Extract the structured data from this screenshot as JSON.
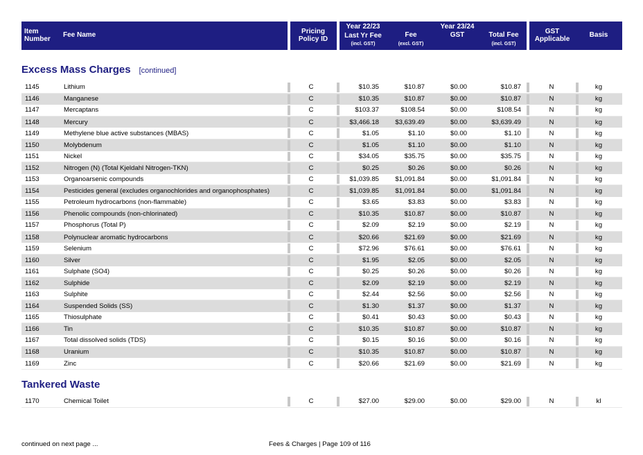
{
  "header": {
    "item_number": "Item Number",
    "fee_name": "Fee Name",
    "pricing_policy": "Pricing Policy ID",
    "year_prev": "Year 22/23",
    "year_prev_sub": "Last Yr Fee",
    "year_prev_note": "(incl. GST)",
    "year_curr": "Year 23/24",
    "fee": "Fee",
    "fee_note": "(excl. GST)",
    "gst": "GST",
    "total_fee": "Total Fee",
    "total_note": "(incl. GST)",
    "gst_applicable": "GST Applicable",
    "basis": "Basis"
  },
  "sections": [
    {
      "title": "Excess Mass Charges",
      "subtitle": "[continued]",
      "rows": [
        {
          "num": "1145",
          "name": "Lithium",
          "policy": "C",
          "prev": "$10.35",
          "fee": "$10.87",
          "gst": "$0.00",
          "total": "$10.87",
          "applicable": "N",
          "basis": "kg"
        },
        {
          "num": "1146",
          "name": "Manganese",
          "policy": "C",
          "prev": "$10.35",
          "fee": "$10.87",
          "gst": "$0.00",
          "total": "$10.87",
          "applicable": "N",
          "basis": "kg"
        },
        {
          "num": "1147",
          "name": "Mercaptans",
          "policy": "C",
          "prev": "$103.37",
          "fee": "$108.54",
          "gst": "$0.00",
          "total": "$108.54",
          "applicable": "N",
          "basis": "kg"
        },
        {
          "num": "1148",
          "name": "Mercury",
          "policy": "C",
          "prev": "$3,466.18",
          "fee": "$3,639.49",
          "gst": "$0.00",
          "total": "$3,639.49",
          "applicable": "N",
          "basis": "kg"
        },
        {
          "num": "1149",
          "name": "Methylene blue active substances (MBAS)",
          "policy": "C",
          "prev": "$1.05",
          "fee": "$1.10",
          "gst": "$0.00",
          "total": "$1.10",
          "applicable": "N",
          "basis": "kg"
        },
        {
          "num": "1150",
          "name": "Molybdenum",
          "policy": "C",
          "prev": "$1.05",
          "fee": "$1.10",
          "gst": "$0.00",
          "total": "$1.10",
          "applicable": "N",
          "basis": "kg"
        },
        {
          "num": "1151",
          "name": "Nickel",
          "policy": "C",
          "prev": "$34.05",
          "fee": "$35.75",
          "gst": "$0.00",
          "total": "$35.75",
          "applicable": "N",
          "basis": "kg"
        },
        {
          "num": "1152",
          "name": "Nitrogen (N) (Total Kjeldahl Nitrogen-TKN)",
          "policy": "C",
          "prev": "$0.25",
          "fee": "$0.26",
          "gst": "$0.00",
          "total": "$0.26",
          "applicable": "N",
          "basis": "kg"
        },
        {
          "num": "1153",
          "name": "Organoarsenic compounds",
          "policy": "C",
          "prev": "$1,039.85",
          "fee": "$1,091.84",
          "gst": "$0.00",
          "total": "$1,091.84",
          "applicable": "N",
          "basis": "kg"
        },
        {
          "num": "1154",
          "name": "Pesticides general (excludes organochlorides and organophosphates)",
          "policy": "C",
          "prev": "$1,039.85",
          "fee": "$1,091.84",
          "gst": "$0.00",
          "total": "$1,091.84",
          "applicable": "N",
          "basis": "kg"
        },
        {
          "num": "1155",
          "name": "Petroleum hydrocarbons (non-flammable)",
          "policy": "C",
          "prev": "$3.65",
          "fee": "$3.83",
          "gst": "$0.00",
          "total": "$3.83",
          "applicable": "N",
          "basis": "kg"
        },
        {
          "num": "1156",
          "name": "Phenolic compounds (non-chlorinated)",
          "policy": "C",
          "prev": "$10.35",
          "fee": "$10.87",
          "gst": "$0.00",
          "total": "$10.87",
          "applicable": "N",
          "basis": "kg"
        },
        {
          "num": "1157",
          "name": "Phosphorus (Total P)",
          "policy": "C",
          "prev": "$2.09",
          "fee": "$2.19",
          "gst": "$0.00",
          "total": "$2.19",
          "applicable": "N",
          "basis": "kg"
        },
        {
          "num": "1158",
          "name": "Polynuclear aromatic hydrocarbons",
          "policy": "C",
          "prev": "$20.66",
          "fee": "$21.69",
          "gst": "$0.00",
          "total": "$21.69",
          "applicable": "N",
          "basis": "kg"
        },
        {
          "num": "1159",
          "name": "Selenium",
          "policy": "C",
          "prev": "$72.96",
          "fee": "$76.61",
          "gst": "$0.00",
          "total": "$76.61",
          "applicable": "N",
          "basis": "kg"
        },
        {
          "num": "1160",
          "name": "Silver",
          "policy": "C",
          "prev": "$1.95",
          "fee": "$2.05",
          "gst": "$0.00",
          "total": "$2.05",
          "applicable": "N",
          "basis": "kg"
        },
        {
          "num": "1161",
          "name": "Sulphate (SO4)",
          "policy": "C",
          "prev": "$0.25",
          "fee": "$0.26",
          "gst": "$0.00",
          "total": "$0.26",
          "applicable": "N",
          "basis": "kg"
        },
        {
          "num": "1162",
          "name": "Sulphide",
          "policy": "C",
          "prev": "$2.09",
          "fee": "$2.19",
          "gst": "$0.00",
          "total": "$2.19",
          "applicable": "N",
          "basis": "kg"
        },
        {
          "num": "1163",
          "name": "Sulphite",
          "policy": "C",
          "prev": "$2.44",
          "fee": "$2.56",
          "gst": "$0.00",
          "total": "$2.56",
          "applicable": "N",
          "basis": "kg"
        },
        {
          "num": "1164",
          "name": "Suspended Solids (SS)",
          "policy": "C",
          "prev": "$1.30",
          "fee": "$1.37",
          "gst": "$0.00",
          "total": "$1.37",
          "applicable": "N",
          "basis": "kg"
        },
        {
          "num": "1165",
          "name": "Thiosulphate",
          "policy": "C",
          "prev": "$0.41",
          "fee": "$0.43",
          "gst": "$0.00",
          "total": "$0.43",
          "applicable": "N",
          "basis": "kg"
        },
        {
          "num": "1166",
          "name": "Tin",
          "policy": "C",
          "prev": "$10.35",
          "fee": "$10.87",
          "gst": "$0.00",
          "total": "$10.87",
          "applicable": "N",
          "basis": "kg"
        },
        {
          "num": "1167",
          "name": "Total dissolved solids (TDS)",
          "policy": "C",
          "prev": "$0.15",
          "fee": "$0.16",
          "gst": "$0.00",
          "total": "$0.16",
          "applicable": "N",
          "basis": "kg"
        },
        {
          "num": "1168",
          "name": "Uranium",
          "policy": "C",
          "prev": "$10.35",
          "fee": "$10.87",
          "gst": "$0.00",
          "total": "$10.87",
          "applicable": "N",
          "basis": "kg"
        },
        {
          "num": "1169",
          "name": "Zinc",
          "policy": "C",
          "prev": "$20.66",
          "fee": "$21.69",
          "gst": "$0.00",
          "total": "$21.69",
          "applicable": "N",
          "basis": "kg"
        }
      ]
    },
    {
      "title": "Tankered Waste",
      "subtitle": "",
      "rows": [
        {
          "num": "1170",
          "name": "Chemical Toilet",
          "policy": "C",
          "prev": "$27.00",
          "fee": "$29.00",
          "gst": "$0.00",
          "total": "$29.00",
          "applicable": "N",
          "basis": "kl"
        }
      ]
    }
  ],
  "footer": {
    "continued": "continued on next page ...",
    "page_info": "Fees & Charges | Page 109 of 116"
  }
}
